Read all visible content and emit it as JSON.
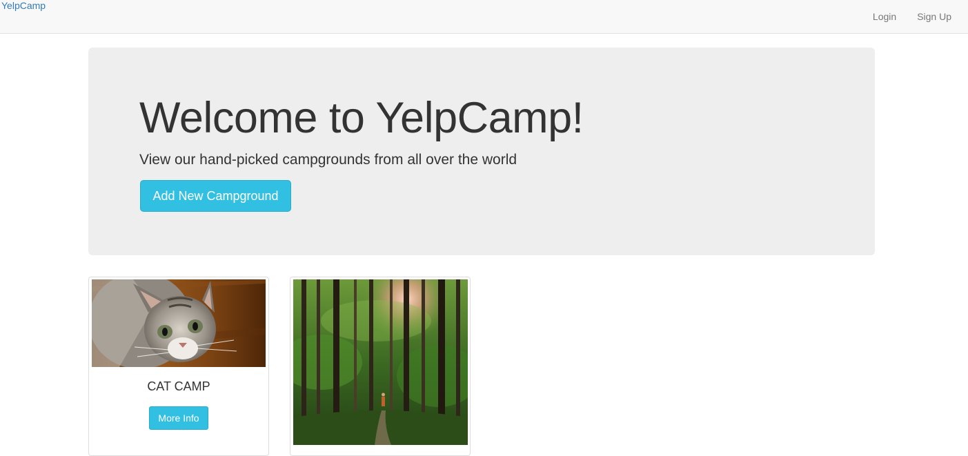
{
  "navbar": {
    "brand": "YelpCamp",
    "links": [
      "Login",
      "Sign Up"
    ]
  },
  "jumbotron": {
    "title": "Welcome to YelpCamp!",
    "subtitle": "View our hand-picked campgrounds from all over the world",
    "add_button": "Add New Campground"
  },
  "campgrounds": [
    {
      "name": "CAT CAMP",
      "button": "More Info",
      "image": "kitten-photo"
    },
    {
      "name": "",
      "button": "",
      "image": "forest-trail-photo"
    }
  ],
  "colors": {
    "accent": "#31c0e2",
    "brand_link": "#337ab7",
    "navbar_bg": "#f8f8f8",
    "jumbotron_bg": "#eeeeee"
  }
}
